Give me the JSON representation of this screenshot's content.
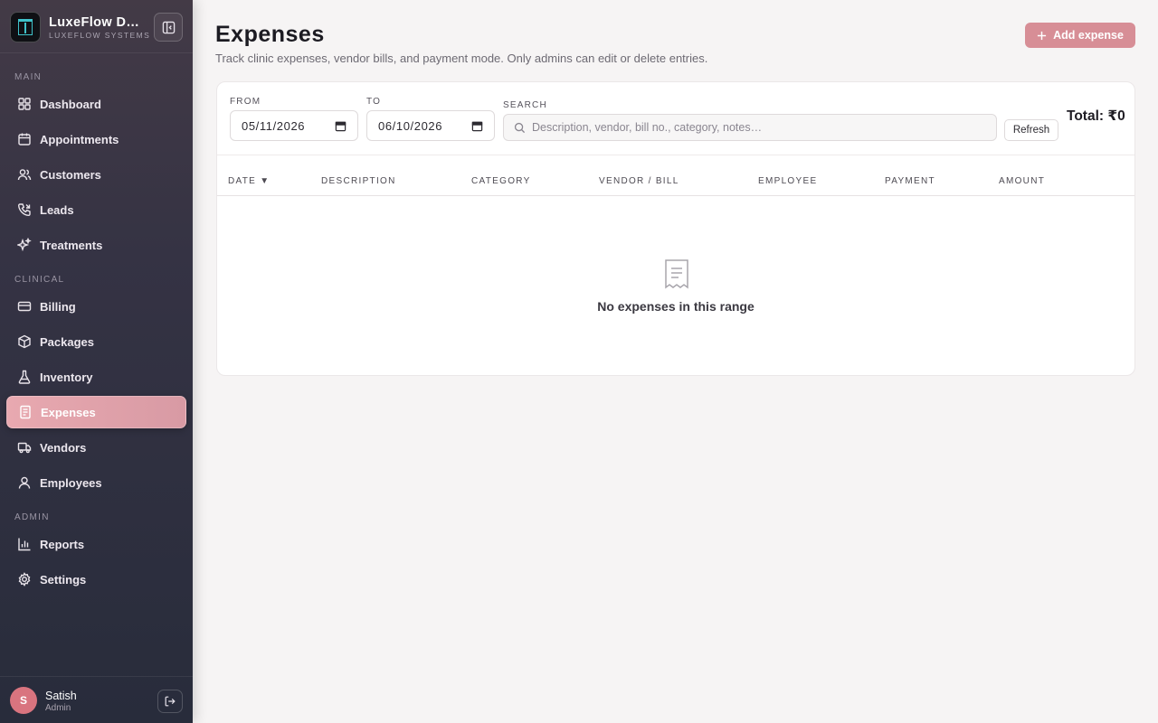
{
  "sidebar": {
    "brand_name": "LuxeFlow Demo",
    "brand_sub": "LUXEFLOW SYSTEMS",
    "sections": {
      "main": "MAIN",
      "clinical": "CLINICAL",
      "admin": "ADMIN"
    },
    "items": [
      {
        "label": "Dashboard",
        "icon": "dashboard-icon"
      },
      {
        "label": "Appointments",
        "icon": "calendar-icon"
      },
      {
        "label": "Customers",
        "icon": "users-icon"
      },
      {
        "label": "Leads",
        "icon": "phone-icon"
      },
      {
        "label": "Treatments",
        "icon": "sparkle-icon"
      },
      {
        "label": "Billing",
        "icon": "card-icon"
      },
      {
        "label": "Packages",
        "icon": "package-icon"
      },
      {
        "label": "Inventory",
        "icon": "flask-icon"
      },
      {
        "label": "Expenses",
        "icon": "receipt-icon",
        "active": true
      },
      {
        "label": "Vendors",
        "icon": "truck-icon"
      },
      {
        "label": "Employees",
        "icon": "user-icon"
      },
      {
        "label": "Reports",
        "icon": "chart-icon"
      },
      {
        "label": "Settings",
        "icon": "gear-icon"
      }
    ],
    "user": {
      "initial": "S",
      "name": "Satish",
      "role": "Admin"
    }
  },
  "header": {
    "title": "Expenses",
    "subtitle": "Track clinic expenses, vendor bills, and payment mode. Only admins can edit or delete entries.",
    "add_label": "Add expense"
  },
  "filters": {
    "from_label": "FROM",
    "from_value": "05/11/2026",
    "to_label": "TO",
    "to_value": "06/10/2026",
    "search_label": "SEARCH",
    "search_placeholder": "Description, vendor, bill no., category, notes…",
    "refresh_label": "Refresh",
    "total": "Total: ₹0"
  },
  "table": {
    "columns": [
      "DATE ▼",
      "DESCRIPTION",
      "CATEGORY",
      "VENDOR / BILL",
      "EMPLOYEE",
      "PAYMENT",
      "AMOUNT"
    ],
    "empty_text": "No expenses in this range"
  },
  "colors": {
    "accent": "#d78e96",
    "sidebar_bg": "#353344",
    "active_item": "#e8a9b0"
  }
}
